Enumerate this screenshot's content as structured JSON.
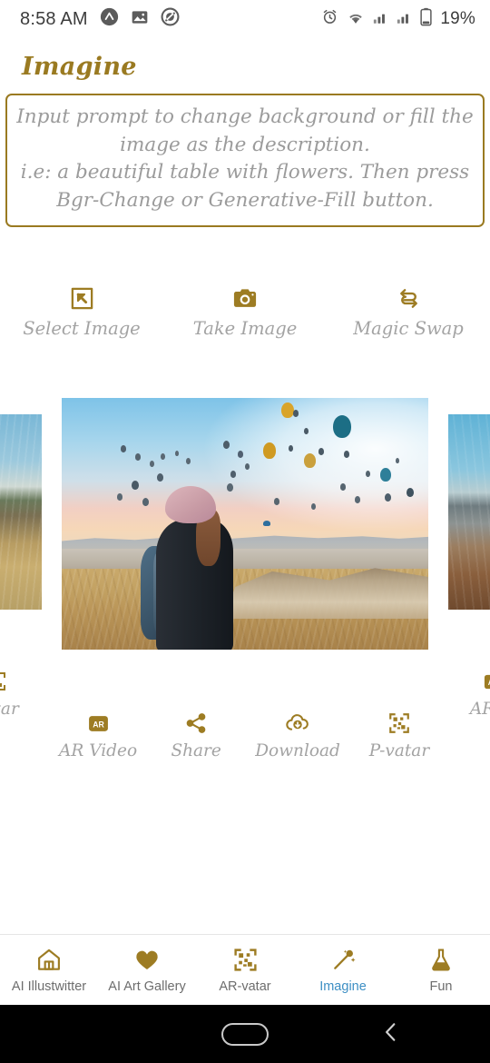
{
  "status_bar": {
    "time": "8:58 AM",
    "battery_percent": "19%",
    "left_icons": [
      "app-notification-icon",
      "image-notification-icon",
      "dnd-notification-icon"
    ],
    "right_icons": [
      "alarm-icon",
      "wifi-icon",
      "signal-sim1-icon",
      "signal-sim2-icon",
      "battery-icon"
    ]
  },
  "header": {
    "title": "Imagine",
    "title_color": "#9a7a21"
  },
  "prompt": {
    "placeholder": "Input prompt to change background or fill the image as the description.\ni.e: a beautiful table with flowers. Then press Bgr-Change or Generative-Fill button.",
    "value": "",
    "border_color": "#9a7a21",
    "text_color": "#9b9b9b"
  },
  "primary_actions": [
    {
      "label": "Select Image",
      "icon": "select-image-icon"
    },
    {
      "label": "Take Image",
      "icon": "camera-icon"
    },
    {
      "label": "Magic Swap",
      "icon": "swap-arrows-icon"
    }
  ],
  "carousel": {
    "slides": [
      {
        "position": "left-peek",
        "alt": "hillside-with-golden-grass"
      },
      {
        "position": "center",
        "alt": "woman-with-backpack-watching-hot-air-balloons-at-sunrise"
      },
      {
        "position": "right-peek",
        "alt": "mountain-ridge-autumn-landscape"
      }
    ],
    "active_index": 1
  },
  "tool_actions": {
    "peek_left": {
      "label": "vatar",
      "icon": "qr-code-icon"
    },
    "peek_right": {
      "label": "AR Vi",
      "icon": "ar-badge-icon"
    },
    "items": [
      {
        "label": "AR Video",
        "icon": "ar-badge-icon"
      },
      {
        "label": "Share",
        "icon": "share-icon"
      },
      {
        "label": "Download",
        "icon": "cloud-download-icon"
      },
      {
        "label": "P-vatar",
        "icon": "qr-code-icon"
      }
    ]
  },
  "bottom_nav": {
    "active": "Imagine",
    "active_color": "#3d8fc4",
    "items": [
      {
        "label": "AI Illustwitter",
        "icon": "home-icon"
      },
      {
        "label": "AI Art Gallery",
        "icon": "heart-icon"
      },
      {
        "label": "AR-vatar",
        "icon": "qr-code-icon"
      },
      {
        "label": "Imagine",
        "icon": "magic-wand-icon"
      },
      {
        "label": "Fun",
        "icon": "flask-icon"
      }
    ]
  },
  "android_nav": {
    "home": "home-pill-button",
    "back": "back-chevron-button"
  },
  "theme": {
    "gold": "#9a7a21",
    "gold_icon": "#9d7c23",
    "muted_text": "#a3a3a3"
  }
}
